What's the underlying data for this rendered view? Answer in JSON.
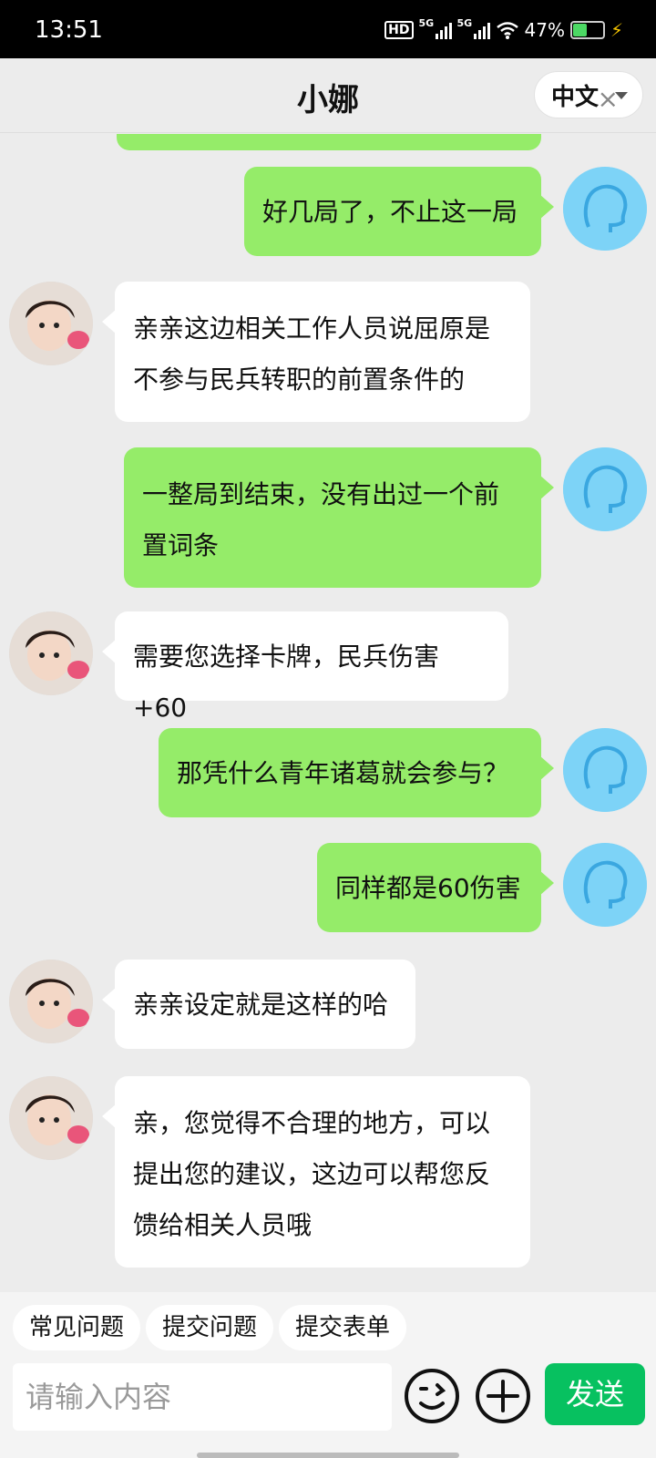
{
  "status_bar": {
    "time": "13:51",
    "hd_label": "HD",
    "signal1_label": "5G",
    "signal2_label": "5G",
    "battery_percent": "47%",
    "battery_level": 0.47
  },
  "header": {
    "title": "小娜",
    "language": "中文"
  },
  "messages": [
    {
      "from": "user",
      "text": "好几局了，不止这一局"
    },
    {
      "from": "agent",
      "text": "亲亲这边相关工作人员说屈原是不参与民兵转职的前置条件的"
    },
    {
      "from": "user",
      "text": "一整局到结束，没有出过一个前置词条"
    },
    {
      "from": "agent",
      "text": "需要您选择卡牌，民兵伤害+60"
    },
    {
      "from": "user",
      "text": "那凭什么青年诸葛就会参与？"
    },
    {
      "from": "user",
      "text": "同样都是60伤害"
    },
    {
      "from": "agent",
      "text": "亲亲设定就是这样的哈"
    },
    {
      "from": "agent",
      "text": "亲，您觉得不合理的地方，可以提出您的建议，这边可以帮您反馈给相关人员哦"
    }
  ],
  "quick_actions": [
    "常见问题",
    "提交问题",
    "提交表单"
  ],
  "input": {
    "placeholder": "请输入内容",
    "value": ""
  },
  "send_label": "发送",
  "icons": {
    "emoji": "emoji-icon",
    "plus": "plus-icon",
    "user_avatar": "user-avatar-icon",
    "agent_avatar": "agent-avatar"
  },
  "colors": {
    "user_bubble": "#95ec69",
    "agent_bubble": "#ffffff",
    "send_button": "#07c160",
    "background": "#ececec"
  }
}
